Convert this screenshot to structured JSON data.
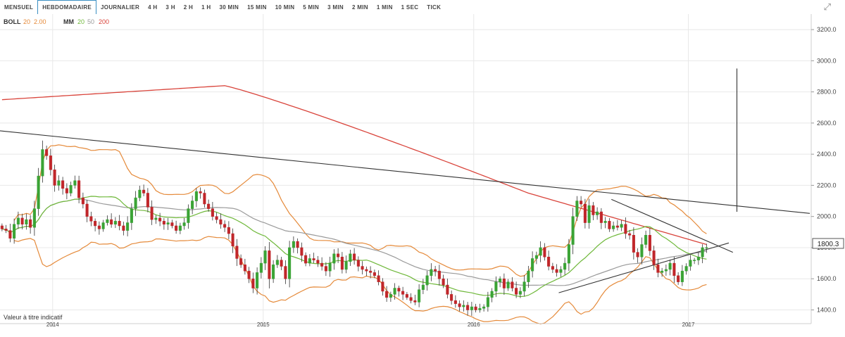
{
  "tabs": [
    "MENSUEL",
    "HEBDOMADAIRE",
    "JOURNALIER",
    "4 H",
    "3 H",
    "2 H",
    "1 H",
    "30 MIN",
    "15 MIN",
    "10 MIN",
    "5 MIN",
    "3 MIN",
    "2 MIN",
    "1 MIN",
    "1 SEC",
    "TICK"
  ],
  "active_tab": 1,
  "legend": {
    "boll_label": "BOLL",
    "boll_params": "20  2.00",
    "mm_label": "MM",
    "mm_20": "20",
    "mm_50": "50",
    "mm_200": "200"
  },
  "disclaimer": "Valeur à titre indicatif",
  "last_price": "1800.3",
  "colors": {
    "bull": "#3aa335",
    "bear": "#c0262a",
    "boll": "#e58a3a",
    "ma20": "#6fb83a",
    "ma50": "#9a9a9a",
    "ma200": "#d9443b",
    "trend": "#333333",
    "grid": "#e8e8e8"
  },
  "chart_data": {
    "type": "candlestick",
    "interval": "weekly",
    "x_ticks": [
      {
        "t": 13,
        "label": "2014"
      },
      {
        "t": 65,
        "label": "2015"
      },
      {
        "t": 117,
        "label": "2016"
      },
      {
        "t": 170,
        "label": "2017"
      }
    ],
    "y_ticks": [
      1400,
      1600,
      1800,
      2000,
      2200,
      2400,
      2600,
      2800,
      3000,
      3200
    ],
    "ylim": [
      1330,
      3250
    ],
    "xlim": [
      0,
      200
    ],
    "closes": [
      1920,
      1910,
      1860,
      1950,
      1990,
      1950,
      1980,
      1930,
      2050,
      2260,
      2430,
      2390,
      2300,
      2200,
      2230,
      2180,
      2150,
      2200,
      2230,
      2120,
      2080,
      2000,
      1970,
      1940,
      1920,
      1960,
      1980,
      1950,
      1970,
      1940,
      1910,
      1960,
      2050,
      2120,
      2170,
      2150,
      2060,
      1980,
      1990,
      1970,
      1950,
      1960,
      1940,
      1910,
      1940,
      1960,
      2050,
      2100,
      2160,
      2150,
      2080,
      2050,
      2000,
      1980,
      1950,
      1930,
      1890,
      1810,
      1730,
      1690,
      1650,
      1600,
      1540,
      1640,
      1700,
      1780,
      1600,
      1690,
      1720,
      1680,
      1600,
      1800,
      1840,
      1800,
      1750,
      1700,
      1730,
      1720,
      1700,
      1680,
      1650,
      1700,
      1760,
      1740,
      1660,
      1710,
      1760,
      1720,
      1680,
      1660,
      1650,
      1640,
      1620,
      1580,
      1520,
      1480,
      1500,
      1540,
      1520,
      1500,
      1480,
      1460,
      1450,
      1530,
      1560,
      1620,
      1660,
      1650,
      1600,
      1560,
      1500,
      1460,
      1440,
      1420,
      1430,
      1400,
      1420,
      1400,
      1410,
      1420,
      1480,
      1520,
      1580,
      1600,
      1540,
      1580,
      1540,
      1500,
      1520,
      1580,
      1650,
      1730,
      1750,
      1800,
      1740,
      1680,
      1660,
      1640,
      1660,
      1700,
      1820,
      2000,
      2100,
      2080,
      1960,
      2070,
      2010,
      2030,
      1960,
      1970,
      1920,
      1940,
      1930,
      1950,
      1890,
      1880,
      1770,
      1740,
      1820,
      1880,
      1780,
      1690,
      1640,
      1650,
      1660,
      1700,
      1620,
      1580,
      1650,
      1680,
      1720,
      1720,
      1740,
      1800,
      1800.3
    ],
    "indicators": [
      "BOLL 20 2.00",
      "MM 20",
      "MM 50",
      "MM 200"
    ],
    "last_price": 1800.3,
    "trendlines": [
      {
        "from": {
          "t": 0,
          "price": 2550
        },
        "to": {
          "t": 200,
          "price": 2020
        }
      },
      {
        "from": {
          "t": 151,
          "price": 2110
        },
        "to": {
          "t": 181,
          "price": 1770
        }
      },
      {
        "from": {
          "t": 138,
          "price": 1510
        },
        "to": {
          "t": 180,
          "price": 1830
        }
      }
    ],
    "vertical_line": {
      "t": 182,
      "from": 2030,
      "to": 2950
    }
  }
}
